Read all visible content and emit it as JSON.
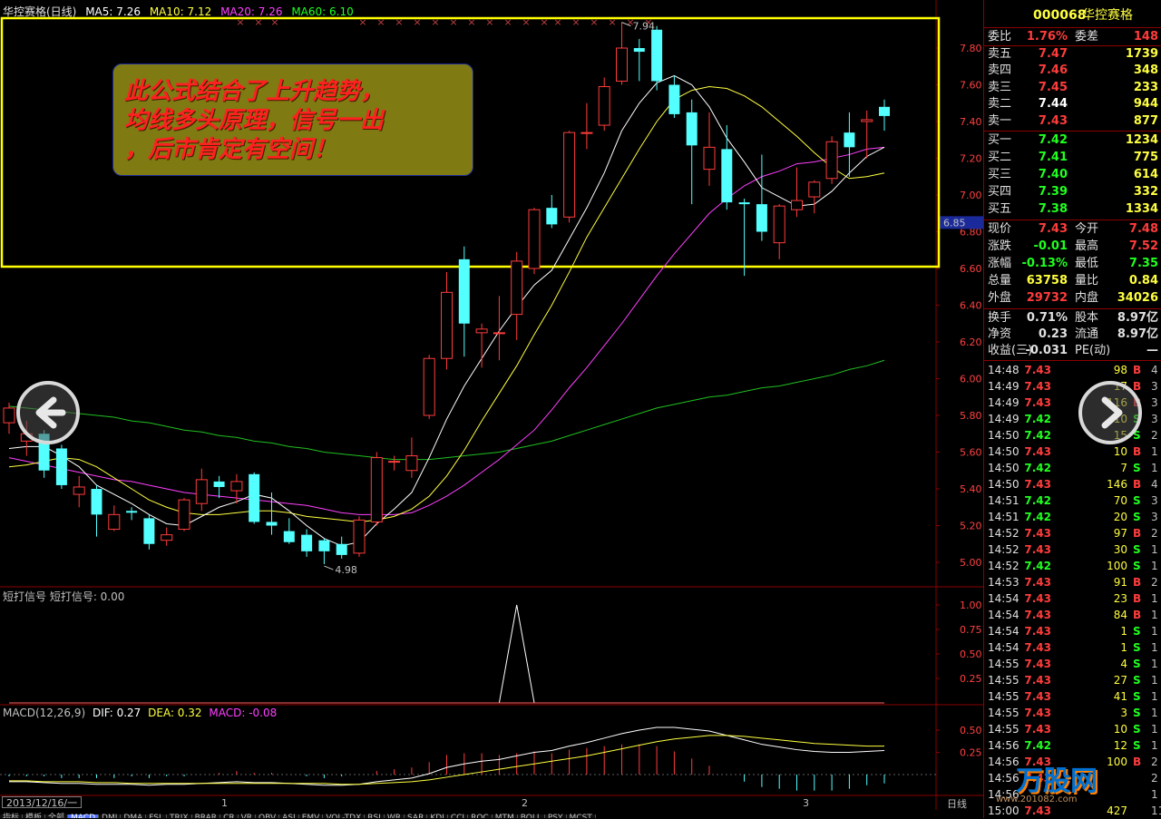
{
  "header": {
    "title": "华控赛格(日线)",
    "ma": [
      {
        "label": "MA5: 7.26",
        "color": "#ffffff"
      },
      {
        "label": "MA10: 7.12",
        "color": "#ffff40"
      },
      {
        "label": "MA20: 7.26",
        "color": "#ff40ff"
      },
      {
        "label": "MA60: 6.10",
        "color": "#20ff20"
      }
    ]
  },
  "callout": {
    "lines": [
      "此公式结合了上升趋势，",
      "均线多头原理，信号一出",
      "，后市肯定有空间！"
    ]
  },
  "price_axis": {
    "ticks": [
      "7.80",
      "7.60",
      "7.40",
      "7.20",
      "7.00",
      "6.80",
      "6.60",
      "6.40",
      "6.20",
      "6.00",
      "5.80",
      "5.60",
      "5.40",
      "5.20",
      "5.00"
    ],
    "current_tag": "6.85"
  },
  "annotations": {
    "high": "7.94",
    "low": "4.98"
  },
  "signal_panel": {
    "label": "短打信号  短打信号: 0.00",
    "ticks": [
      "1.00",
      "0.75",
      "0.50",
      "0.25"
    ]
  },
  "macd_panel": {
    "label_main": "MACD(12,26,9)",
    "dif": "DIF: 0.27",
    "dea": "DEA: 0.32",
    "macd": "MACD: -0.08",
    "ticks": [
      "0.50",
      "0.25"
    ]
  },
  "x_axis": {
    "date_box": "2013/12/16/一",
    "ticks": [
      "1",
      "2",
      "3"
    ],
    "period": "日线"
  },
  "tabs": [
    "指标",
    "模板",
    "全部",
    "MACD",
    "DMI",
    "DMA",
    "FSL",
    "TRIX",
    "BRAR",
    "CR",
    "VR",
    "OBV",
    "ASI",
    "EMV",
    "VOL-TDX",
    "RSI",
    "WR",
    "SAR",
    "KDJ",
    "CCI",
    "ROC",
    "MTM",
    "BOLL",
    "PSY",
    "MCST"
  ],
  "active_tab": "MACD",
  "quote": {
    "code": "000068",
    "name": "华控赛格",
    "wei": {
      "l1": "委比",
      "v1": "1.76%",
      "l2": "委差",
      "v2": "148"
    },
    "asks": [
      {
        "label": "卖五",
        "price": "7.47",
        "vol": "1739"
      },
      {
        "label": "卖四",
        "price": "7.46",
        "vol": "348"
      },
      {
        "label": "卖三",
        "price": "7.45",
        "vol": "233"
      },
      {
        "label": "卖二",
        "price": "7.44",
        "vol": "944"
      },
      {
        "label": "卖一",
        "price": "7.43",
        "vol": "877"
      }
    ],
    "bids": [
      {
        "label": "买一",
        "price": "7.42",
        "vol": "1234"
      },
      {
        "label": "买二",
        "price": "7.41",
        "vol": "775"
      },
      {
        "label": "买三",
        "price": "7.40",
        "vol": "614"
      },
      {
        "label": "买四",
        "price": "7.39",
        "vol": "332"
      },
      {
        "label": "买五",
        "price": "7.38",
        "vol": "1334"
      }
    ],
    "stats": [
      {
        "l1": "现价",
        "v1": "7.43",
        "c1": "red",
        "l2": "今开",
        "v2": "7.48",
        "c2": "red"
      },
      {
        "l1": "涨跌",
        "v1": "-0.01",
        "c1": "green",
        "l2": "最高",
        "v2": "7.52",
        "c2": "red"
      },
      {
        "l1": "涨幅",
        "v1": "-0.13%",
        "c1": "green",
        "l2": "最低",
        "v2": "7.35",
        "c2": "green"
      },
      {
        "l1": "总量",
        "v1": "63758",
        "c1": "yellow",
        "l2": "量比",
        "v2": "0.84",
        "c2": "yellow"
      },
      {
        "l1": "外盘",
        "v1": "29732",
        "c1": "red",
        "l2": "内盘",
        "v2": "34026",
        "c2": "yellow"
      }
    ],
    "stats2": [
      {
        "l1": "换手",
        "v1": "0.71%",
        "l2": "股本",
        "v2": "8.97亿"
      },
      {
        "l1": "净资",
        "v1": "0.23",
        "l2": "流通",
        "v2": "8.97亿"
      },
      {
        "l1": "收益(三)",
        "v1": "-0.031",
        "l2": "PE(动)",
        "v2": "—"
      }
    ],
    "ticks": [
      {
        "t": "14:48",
        "p": "7.43",
        "v": "98",
        "s": "B",
        "n": "4"
      },
      {
        "t": "14:49",
        "p": "7.43",
        "v": "17",
        "s": "B",
        "n": "3"
      },
      {
        "t": "14:49",
        "p": "7.43",
        "v": "116",
        "s": "B",
        "n": "3"
      },
      {
        "t": "14:49",
        "p": "7.42",
        "v": "10",
        "s": "S",
        "n": "3"
      },
      {
        "t": "14:50",
        "p": "7.42",
        "v": "15",
        "s": "S",
        "n": "2"
      },
      {
        "t": "14:50",
        "p": "7.43",
        "v": "10",
        "s": "B",
        "n": "1"
      },
      {
        "t": "14:50",
        "p": "7.42",
        "v": "7",
        "s": "S",
        "n": "1"
      },
      {
        "t": "14:50",
        "p": "7.43",
        "v": "146",
        "s": "B",
        "n": "4"
      },
      {
        "t": "14:51",
        "p": "7.42",
        "v": "70",
        "s": "S",
        "n": "3"
      },
      {
        "t": "14:51",
        "p": "7.42",
        "v": "20",
        "s": "S",
        "n": "3"
      },
      {
        "t": "14:52",
        "p": "7.43",
        "v": "97",
        "s": "B",
        "n": "2"
      },
      {
        "t": "14:52",
        "p": "7.43",
        "v": "30",
        "s": "S",
        "n": "1"
      },
      {
        "t": "14:52",
        "p": "7.42",
        "v": "100",
        "s": "S",
        "n": "1"
      },
      {
        "t": "14:53",
        "p": "7.43",
        "v": "91",
        "s": "B",
        "n": "2"
      },
      {
        "t": "14:54",
        "p": "7.43",
        "v": "23",
        "s": "B",
        "n": "1"
      },
      {
        "t": "14:54",
        "p": "7.43",
        "v": "84",
        "s": "B",
        "n": "1"
      },
      {
        "t": "14:54",
        "p": "7.43",
        "v": "1",
        "s": "S",
        "n": "1"
      },
      {
        "t": "14:54",
        "p": "7.43",
        "v": "1",
        "s": "S",
        "n": "1"
      },
      {
        "t": "14:55",
        "p": "7.43",
        "v": "4",
        "s": "S",
        "n": "1"
      },
      {
        "t": "14:55",
        "p": "7.43",
        "v": "27",
        "s": "S",
        "n": "1"
      },
      {
        "t": "14:55",
        "p": "7.43",
        "v": "41",
        "s": "S",
        "n": "1"
      },
      {
        "t": "14:55",
        "p": "7.43",
        "v": "3",
        "s": "S",
        "n": "1"
      },
      {
        "t": "14:55",
        "p": "7.43",
        "v": "10",
        "s": "S",
        "n": "1"
      },
      {
        "t": "14:56",
        "p": "7.42",
        "v": "12",
        "s": "S",
        "n": "1"
      },
      {
        "t": "14:56",
        "p": "7.43",
        "v": "100",
        "s": "B",
        "n": "2"
      },
      {
        "t": "14:56",
        "p": "7.43",
        "v": "",
        "s": "",
        "n": "2"
      },
      {
        "t": "14:56",
        "p": "",
        "v": "",
        "s": "",
        "n": "1"
      },
      {
        "t": "15:00",
        "p": "7.43",
        "v": "427",
        "s": "",
        "n": "11"
      }
    ]
  },
  "watermark": {
    "text": "万股网",
    "url": "www.201082.com"
  },
  "chart_data": {
    "type": "candlestick",
    "ylim": [
      4.9,
      7.95
    ],
    "candles": [
      [
        5.76,
        5.87,
        5.7,
        5.84
      ],
      [
        5.66,
        5.77,
        5.58,
        5.7
      ],
      [
        5.7,
        5.72,
        5.46,
        5.5
      ],
      [
        5.62,
        5.64,
        5.4,
        5.42
      ],
      [
        5.37,
        5.47,
        5.3,
        5.41
      ],
      [
        5.4,
        5.42,
        5.14,
        5.26
      ],
      [
        5.18,
        5.31,
        5.17,
        5.26
      ],
      [
        5.28,
        5.3,
        5.23,
        5.27
      ],
      [
        5.24,
        5.26,
        5.07,
        5.1
      ],
      [
        5.12,
        5.19,
        5.09,
        5.15
      ],
      [
        5.18,
        5.35,
        5.17,
        5.34
      ],
      [
        5.32,
        5.51,
        5.28,
        5.45
      ],
      [
        5.44,
        5.47,
        5.35,
        5.41
      ],
      [
        5.39,
        5.48,
        5.32,
        5.44
      ],
      [
        5.48,
        5.49,
        5.21,
        5.22
      ],
      [
        5.22,
        5.38,
        5.15,
        5.2
      ],
      [
        5.17,
        5.24,
        5.1,
        5.11
      ],
      [
        5.15,
        5.18,
        5.03,
        5.06
      ],
      [
        5.12,
        5.13,
        4.99,
        5.06
      ],
      [
        5.1,
        5.14,
        5.02,
        5.04
      ],
      [
        5.05,
        5.25,
        5.03,
        5.23
      ],
      [
        5.22,
        5.6,
        5.2,
        5.57
      ],
      [
        5.55,
        5.58,
        5.5,
        5.55
      ],
      [
        5.5,
        5.68,
        5.46,
        5.58
      ],
      [
        5.8,
        6.13,
        5.78,
        6.11
      ],
      [
        6.11,
        6.58,
        6.05,
        6.47
      ],
      [
        6.65,
        6.72,
        6.12,
        6.3
      ],
      [
        6.25,
        6.3,
        6.06,
        6.27
      ],
      [
        6.25,
        6.45,
        6.1,
        6.25
      ],
      [
        6.35,
        6.69,
        6.21,
        6.64
      ],
      [
        6.6,
        6.93,
        6.57,
        6.92
      ],
      [
        6.93,
        7.0,
        6.82,
        6.84
      ],
      [
        6.88,
        7.35,
        6.85,
        7.34
      ],
      [
        7.34,
        7.5,
        7.25,
        7.34
      ],
      [
        7.38,
        7.64,
        7.35,
        7.59
      ],
      [
        7.62,
        7.94,
        7.6,
        7.8
      ],
      [
        7.8,
        7.85,
        7.62,
        7.78
      ],
      [
        7.9,
        7.92,
        7.57,
        7.62
      ],
      [
        7.6,
        7.65,
        7.42,
        7.44
      ],
      [
        7.45,
        7.52,
        6.95,
        7.27
      ],
      [
        7.14,
        7.45,
        7.05,
        7.26
      ],
      [
        7.25,
        7.38,
        6.92,
        6.96
      ],
      [
        6.96,
        6.98,
        6.56,
        6.95
      ],
      [
        6.95,
        7.22,
        6.75,
        6.8
      ],
      [
        6.74,
        6.95,
        6.65,
        6.94
      ],
      [
        6.92,
        7.15,
        6.88,
        6.97
      ],
      [
        6.99,
        7.08,
        6.9,
        7.07
      ],
      [
        7.09,
        7.32,
        7.06,
        7.29
      ],
      [
        7.34,
        7.45,
        7.1,
        7.26
      ],
      [
        7.4,
        7.46,
        7.2,
        7.41
      ],
      [
        7.48,
        7.52,
        7.35,
        7.43
      ]
    ],
    "ma5": [
      5.62,
      5.63,
      5.63,
      5.58,
      5.52,
      5.42,
      5.37,
      5.32,
      5.26,
      5.21,
      5.2,
      5.25,
      5.3,
      5.33,
      5.37,
      5.35,
      5.28,
      5.2,
      5.13,
      5.09,
      5.11,
      5.21,
      5.29,
      5.38,
      5.57,
      5.78,
      5.96,
      6.11,
      6.26,
      6.39,
      6.51,
      6.59,
      6.76,
      6.93,
      7.12,
      7.35,
      7.5,
      7.61,
      7.65,
      7.6,
      7.48,
      7.31,
      7.18,
      7.04,
      6.99,
      6.94,
      6.95,
      7.02,
      7.12,
      7.21,
      7.26
    ],
    "ma10": [
      5.52,
      5.53,
      5.55,
      5.57,
      5.56,
      5.52,
      5.46,
      5.4,
      5.34,
      5.3,
      5.27,
      5.26,
      5.26,
      5.27,
      5.28,
      5.28,
      5.27,
      5.25,
      5.24,
      5.23,
      5.22,
      5.23,
      5.25,
      5.29,
      5.36,
      5.47,
      5.61,
      5.77,
      5.92,
      6.07,
      6.24,
      6.4,
      6.58,
      6.77,
      6.93,
      7.09,
      7.25,
      7.4,
      7.52,
      7.57,
      7.59,
      7.58,
      7.54,
      7.48,
      7.4,
      7.32,
      7.23,
      7.15,
      7.09,
      7.1,
      7.12
    ],
    "ma20": [
      5.57,
      5.55,
      5.53,
      5.51,
      5.49,
      5.47,
      5.45,
      5.44,
      5.42,
      5.4,
      5.38,
      5.37,
      5.36,
      5.35,
      5.34,
      5.33,
      5.32,
      5.31,
      5.29,
      5.27,
      5.26,
      5.26,
      5.26,
      5.27,
      5.31,
      5.36,
      5.42,
      5.49,
      5.56,
      5.64,
      5.72,
      5.83,
      5.95,
      6.06,
      6.18,
      6.3,
      6.43,
      6.56,
      6.68,
      6.79,
      6.9,
      6.98,
      7.05,
      7.1,
      7.13,
      7.17,
      7.18,
      7.2,
      7.22,
      7.25,
      7.26
    ],
    "ma60": [
      5.85,
      5.84,
      5.83,
      5.82,
      5.81,
      5.8,
      5.79,
      5.77,
      5.76,
      5.74,
      5.72,
      5.71,
      5.69,
      5.68,
      5.66,
      5.65,
      5.63,
      5.62,
      5.6,
      5.59,
      5.58,
      5.57,
      5.56,
      5.56,
      5.56,
      5.57,
      5.58,
      5.59,
      5.6,
      5.62,
      5.64,
      5.66,
      5.69,
      5.72,
      5.75,
      5.78,
      5.81,
      5.84,
      5.86,
      5.88,
      5.9,
      5.91,
      5.93,
      5.95,
      5.96,
      5.98,
      6.0,
      6.02,
      6.05,
      6.07,
      6.1
    ],
    "signal": {
      "index": 29,
      "value": 1.0
    },
    "macd_dif": [
      -0.08,
      -0.08,
      -0.09,
      -0.1,
      -0.1,
      -0.11,
      -0.11,
      -0.11,
      -0.12,
      -0.11,
      -0.11,
      -0.1,
      -0.09,
      -0.08,
      -0.09,
      -0.09,
      -0.1,
      -0.11,
      -0.12,
      -0.12,
      -0.11,
      -0.08,
      -0.06,
      -0.04,
      0.01,
      0.08,
      0.12,
      0.15,
      0.17,
      0.21,
      0.25,
      0.27,
      0.32,
      0.36,
      0.41,
      0.46,
      0.5,
      0.53,
      0.53,
      0.51,
      0.49,
      0.44,
      0.39,
      0.34,
      0.31,
      0.28,
      0.26,
      0.25,
      0.25,
      0.26,
      0.27
    ],
    "macd_dea": [
      -0.07,
      -0.07,
      -0.08,
      -0.08,
      -0.08,
      -0.09,
      -0.09,
      -0.1,
      -0.1,
      -0.1,
      -0.1,
      -0.1,
      -0.1,
      -0.1,
      -0.1,
      -0.1,
      -0.1,
      -0.1,
      -0.1,
      -0.11,
      -0.11,
      -0.1,
      -0.09,
      -0.08,
      -0.06,
      -0.03,
      0.0,
      0.03,
      0.06,
      0.09,
      0.12,
      0.15,
      0.18,
      0.21,
      0.25,
      0.29,
      0.33,
      0.37,
      0.4,
      0.42,
      0.44,
      0.44,
      0.43,
      0.41,
      0.39,
      0.37,
      0.35,
      0.34,
      0.33,
      0.32,
      0.32
    ],
    "macd_hist_sign_note": "bars = 2*(dif-dea)"
  }
}
